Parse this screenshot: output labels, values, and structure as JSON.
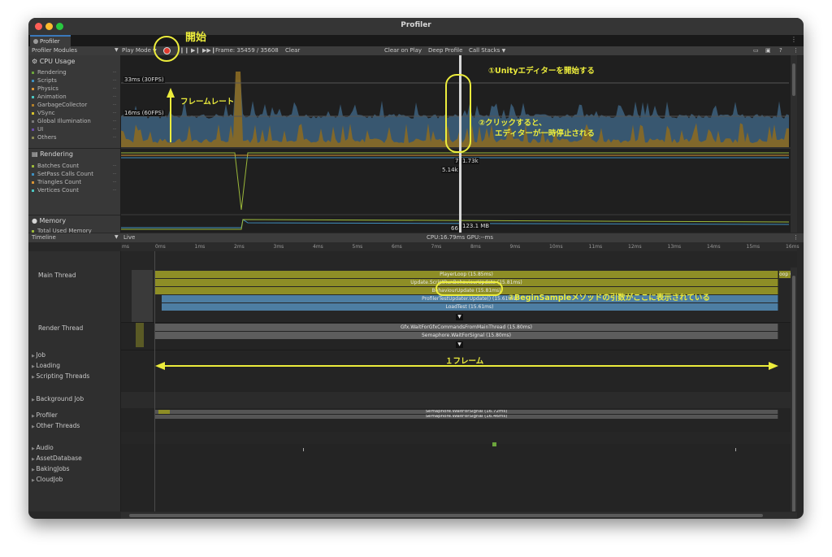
{
  "window": {
    "title": "Profiler",
    "tab": "Profiler"
  },
  "toolbar": {
    "modules_label": "Profiler Modules",
    "play_mode": "Play Mode",
    "frame": "Frame: 35459 / 35608",
    "clear": "Clear",
    "clear_on_play": "Clear on Play",
    "deep_profile": "Deep Profile",
    "call_stacks": "Call Stacks"
  },
  "cpu_module": {
    "title": "CPU Usage",
    "series": [
      {
        "label": "Rendering",
        "color": "#6ca53c"
      },
      {
        "label": "Scripts",
        "color": "#3f8fbf"
      },
      {
        "label": "Physics",
        "color": "#d99436"
      },
      {
        "label": "Animation",
        "color": "#4cc5c1"
      },
      {
        "label": "GarbageCollector",
        "color": "#b07e2a"
      },
      {
        "label": "VSync",
        "color": "#d8c32e"
      },
      {
        "label": "Global Illumination",
        "color": "#7a7a7a"
      },
      {
        "label": "UI",
        "color": "#6a4ca8"
      },
      {
        "label": "Others",
        "color": "#8a8a55"
      }
    ],
    "line_30fps": "33ms (30FPS)",
    "line_60fps": "16ms (60FPS)"
  },
  "rendering_module": {
    "title": "Rendering",
    "series": [
      {
        "label": "Batches Count",
        "color": "#9bb83a"
      },
      {
        "label": "SetPass Calls Count",
        "color": "#3f8fbf"
      },
      {
        "label": "Triangles Count",
        "color": "#d99436"
      },
      {
        "label": "Vertices Count",
        "color": "#4cc5c1"
      }
    ],
    "val_a": "7",
    "val_b": "1.73k",
    "val_c": "5.14k"
  },
  "memory_module": {
    "title": "Memory",
    "series_first": "Total Used Memory",
    "val_a": "66",
    "val_b": "123.1 MB"
  },
  "timeline_bar": {
    "view": "Timeline",
    "live": "Live",
    "stats": "CPU:16.79ms   GPU:--ms"
  },
  "ruler": [
    "0ms",
    "1ms",
    "2ms",
    "3ms",
    "4ms",
    "5ms",
    "6ms",
    "7ms",
    "8ms",
    "9ms",
    "10ms",
    "11ms",
    "12ms",
    "13ms",
    "14ms",
    "15ms",
    "16ms"
  ],
  "ruler_left": "ms",
  "threads": [
    "Main Thread",
    "Render Thread",
    "Job",
    "Loading",
    "Scripting Threads",
    "Background Job",
    "Profiler",
    "Other Threads",
    "Audio",
    "AssetDatabase",
    "BakingJobs",
    "CloudJob"
  ],
  "main_thread_samples": [
    {
      "label": "PlayerLoop (15.85ms)",
      "color": "#8e8e26"
    },
    {
      "label": "Update.ScriptRunBehaviourUpdate (15.81ms)",
      "color": "#8e8e26"
    },
    {
      "label": "BehaviourUpdate (15.81ms)",
      "color": "#8e8e26"
    },
    {
      "label": "ProfilerTestUpdater.Update() (15.61ms)",
      "color": "#4d7ea3"
    },
    {
      "label": "LoadTest (15.61ms)",
      "color": "#4d7ea3"
    }
  ],
  "right_clip_label": "oop (0",
  "render_thread_samples": [
    {
      "label": "Gfx.WaitForGfxCommandsFromMainThread (15.80ms)"
    },
    {
      "label": "Semaphore.WaitForSignal (15.80ms)"
    }
  ],
  "profiler_samples": [
    {
      "label": "Semaphore.WaitForSignal (16.72ms)"
    },
    {
      "label": "Semaphore.WaitForSignal (16.46ms)"
    }
  ],
  "annotations": {
    "start": "開始",
    "framerate": "フレームレート",
    "step1": "①Unityエディターを開始する",
    "step2a": "②クリックすると、",
    "step2b": "エディターが一時停止される",
    "step3": "③BeginSampleメソッドの引数がここに表示されている",
    "one_frame": "１フレーム",
    "color": "#ecec3c"
  }
}
